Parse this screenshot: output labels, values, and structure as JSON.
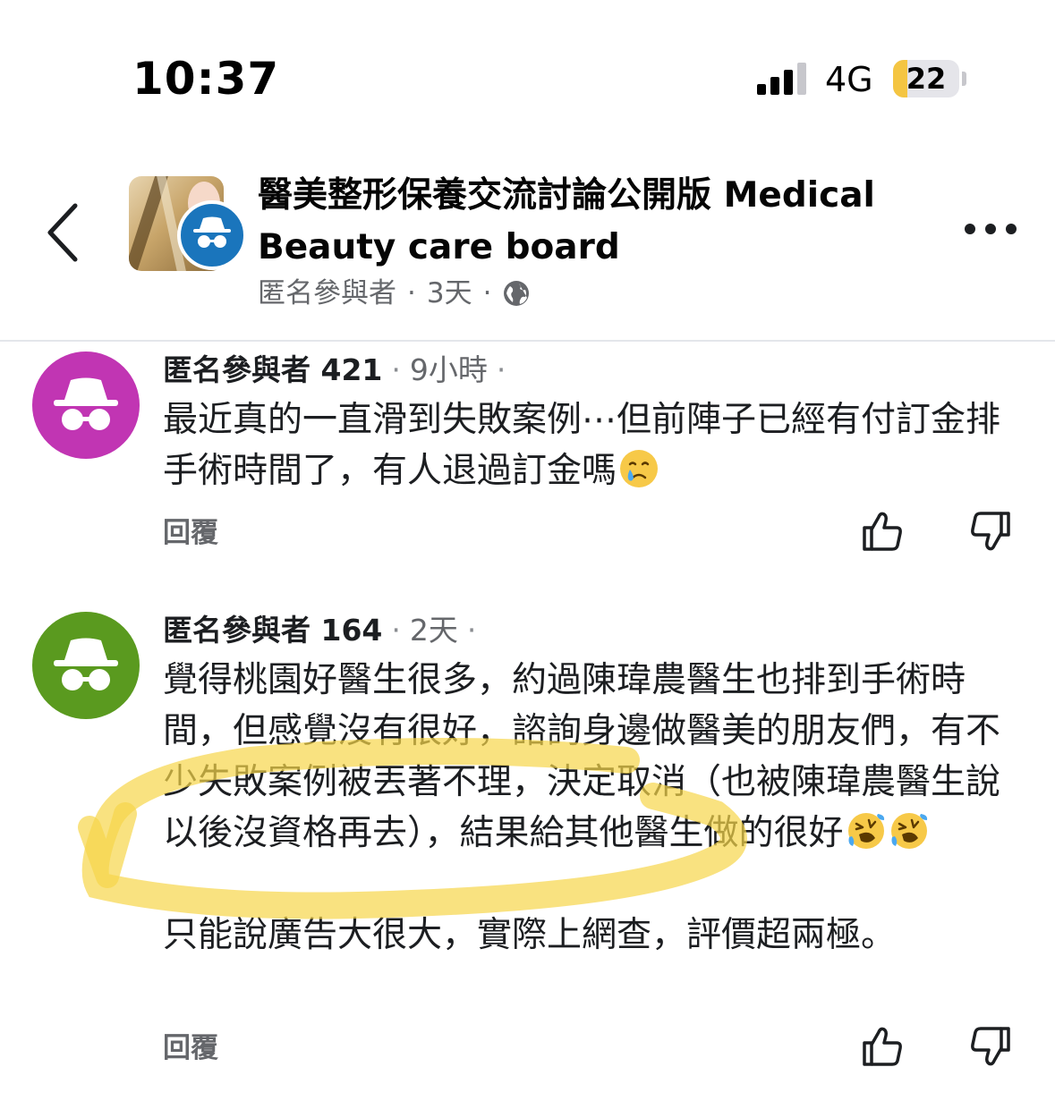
{
  "status_bar": {
    "time": "10:37",
    "network": "4G",
    "battery": "22",
    "battery_level": 0.22
  },
  "header": {
    "group_title": "醫美整形保養交流討論公開版 Medical Beauty care board",
    "post_author": "匿名參與者",
    "post_age": "3天",
    "separator": "·",
    "privacy_icon": "globe-icon",
    "back_icon": "chevron-left-icon",
    "more_icon": "more-horizontal-icon"
  },
  "comments": [
    {
      "author": "匿名參與者 421",
      "time": "9小時",
      "separator": "·",
      "avatar_color": "#c135b3",
      "body_lines": [
        "最近真的一直滑到失敗案例⋯但前陣子已經有付訂金排手術時間了，有人退過訂金嗎"
      ],
      "emoji": "crying-face-emoji",
      "reply_label": "回覆",
      "like_icon": "thumbs-up-icon",
      "dislike_icon": "thumbs-down-icon"
    },
    {
      "author": "匿名參與者 164",
      "time": "2天",
      "separator": "·",
      "avatar_color": "#5a9a1f",
      "body_paragraph_1": "覺得桃園好醫生很多，約過陳瑋農醫生也排到手術時間，但感覺沒有很好，諮詢身邊做醫美的朋友們，有不少失敗案例被丟著不理，決定取消（也被陳瑋農醫生說以後沒資格再去），結果給其他醫生做的很好",
      "emoji": "rolling-on-floor-laughing-emoji",
      "body_paragraph_2": "只能說廣告大很大，實際上網查，評價超兩極。",
      "reply_label": "回覆",
      "like_icon": "thumbs-up-icon",
      "dislike_icon": "thumbs-down-icon",
      "highlight_color": "#f7d54a"
    }
  ]
}
